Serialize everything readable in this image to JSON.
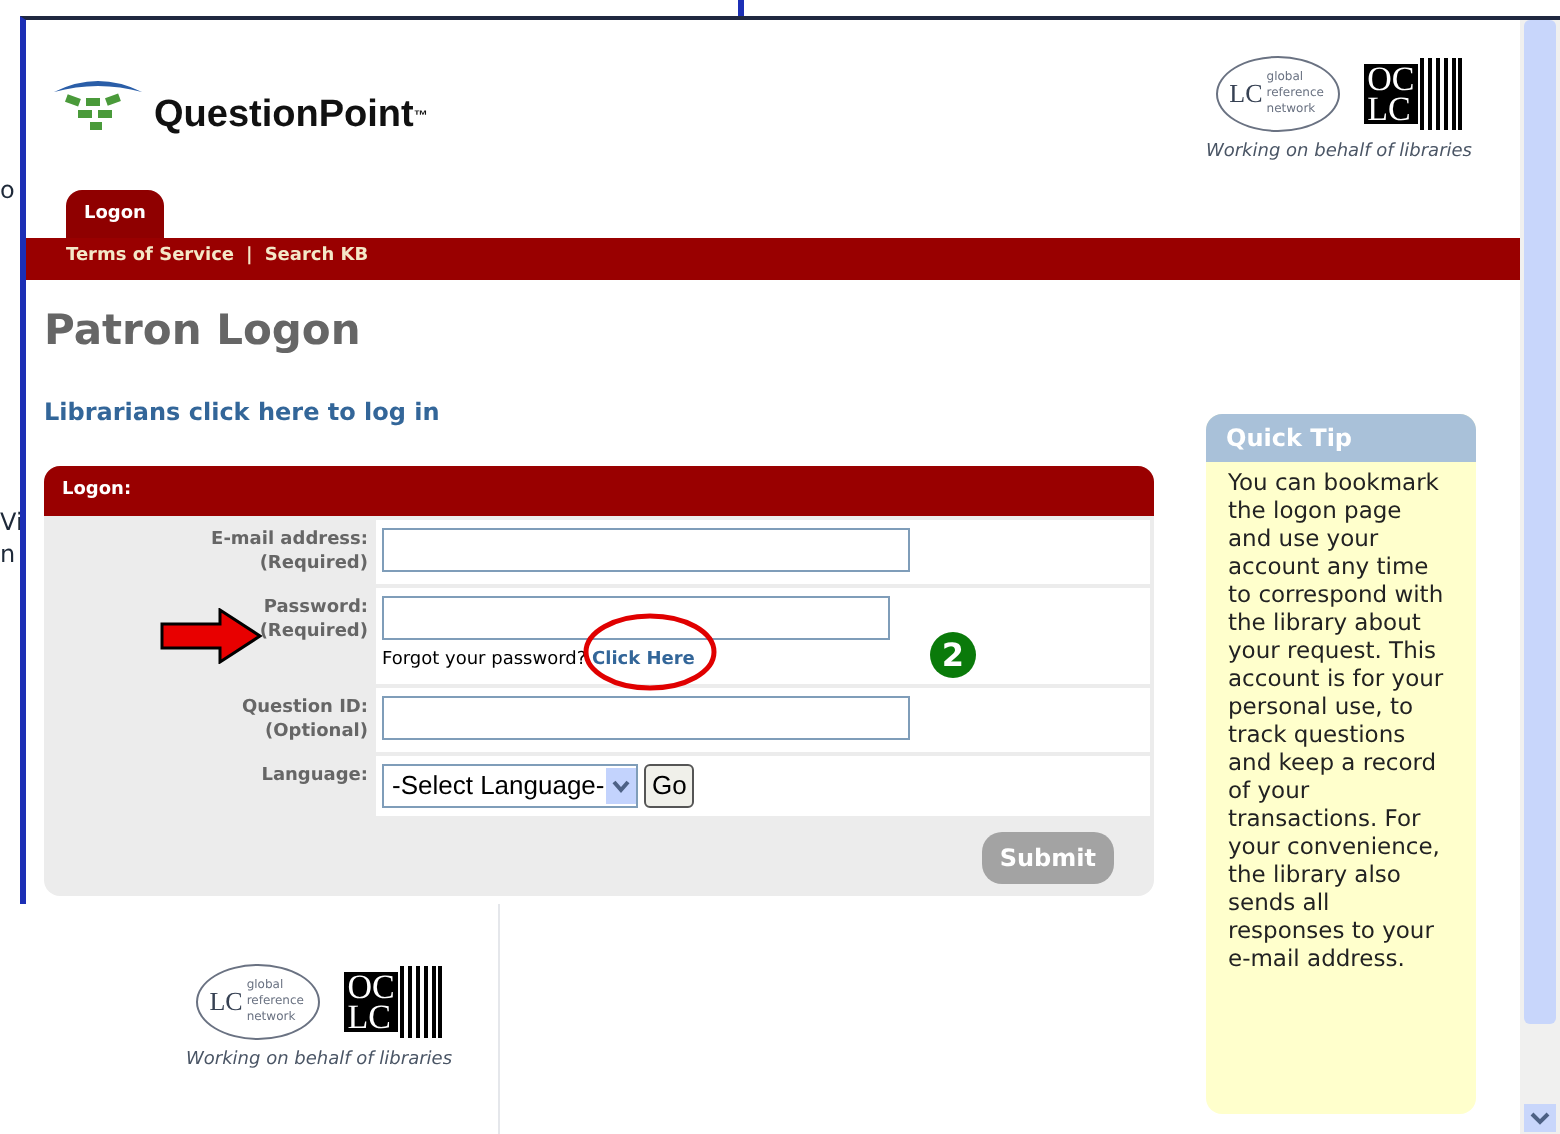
{
  "background_window": {
    "fragments": [
      "o",
      "Vi",
      "n"
    ]
  },
  "header": {
    "logo": {
      "name": "QuestionPoint",
      "mark": "™"
    },
    "partner_logo": {
      "lc": "LC",
      "lines": [
        "global",
        "reference",
        "network"
      ],
      "oclc": [
        "OC",
        "LC"
      ],
      "tagline": "Working on behalf of libraries"
    }
  },
  "tabs": [
    {
      "label": "Logon",
      "selected": true
    }
  ],
  "nav_links": [
    "Terms of Service",
    "Search KB"
  ],
  "nav_separator": "|",
  "page_title": "Patron Logon",
  "librarian_link": "Librarians click here to log in",
  "form": {
    "title": "Logon:",
    "fields": [
      {
        "kind": "text",
        "label": "E-mail address:",
        "note": "(Required)"
      },
      {
        "kind": "password",
        "label": "Password:",
        "note": "(Required)",
        "help": "Forgot your password?",
        "help_link": "Click Here"
      },
      {
        "kind": "text",
        "label": "Question ID:",
        "note": "(Optional)"
      },
      {
        "kind": "select",
        "label": "Language:",
        "value": "-Select Language-",
        "button": "Go"
      }
    ],
    "submit": "Submit"
  },
  "quick_tip": {
    "title": "Quick Tip",
    "text": "You can bookmark the logon page and use your account any time to correspond with the library about your request. This account is for your personal use, to track questions and keep a record of your transactions. For your convenience, the library also sends all responses to your e-mail address."
  },
  "annotations": {
    "step": "2"
  },
  "footer_logo": {
    "lc": "LC",
    "lines": [
      "global",
      "reference",
      "network"
    ],
    "oclc": [
      "OC",
      "LC"
    ],
    "tagline": "Working on behalf of libraries"
  }
}
